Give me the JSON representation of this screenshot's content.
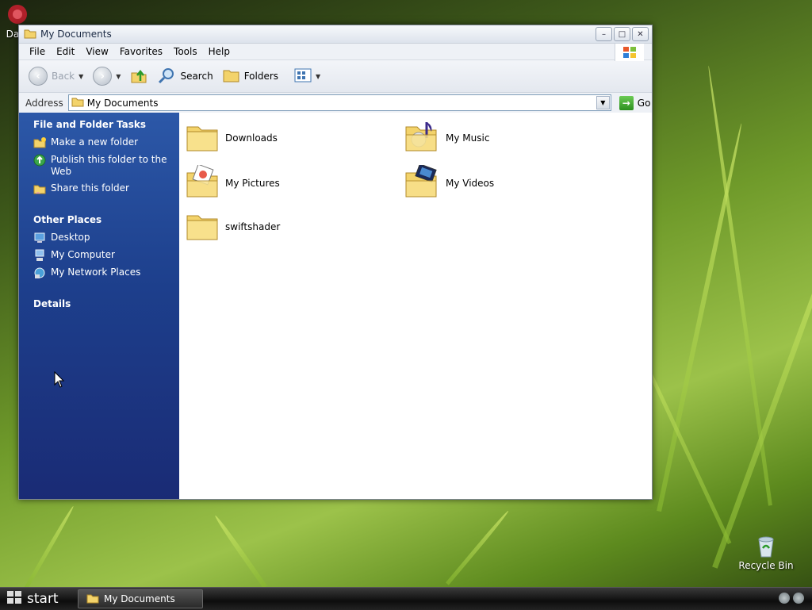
{
  "desktop": {
    "top_left_icon_label": "Data",
    "recycle_bin_label": "Recycle Bin"
  },
  "window": {
    "title": "My Documents",
    "controls": {
      "minimize": "–",
      "maximize": "□",
      "close": "✕"
    }
  },
  "menu": [
    "File",
    "Edit",
    "View",
    "Favorites",
    "Tools",
    "Help"
  ],
  "toolbar": {
    "back": "Back",
    "search": "Search",
    "folders": "Folders"
  },
  "address": {
    "label": "Address",
    "value": "My Documents",
    "go": "Go"
  },
  "taskpane": {
    "file_tasks_title": "File and Folder Tasks",
    "file_tasks": [
      "Make a new folder",
      "Publish this folder to the Web",
      "Share this folder"
    ],
    "other_places_title": "Other Places",
    "other_places": [
      "Desktop",
      "My Computer",
      "My Network Places"
    ],
    "details_title": "Details"
  },
  "folders": [
    "Downloads",
    "My Music",
    "My Pictures",
    "My Videos",
    "swiftshader"
  ],
  "taskbar": {
    "start_label": "start",
    "window_button": "My Documents"
  },
  "colors": {
    "taskpane_top": "#2c58a8",
    "taskpane_bottom": "#1a2b75",
    "folder_yellow": "#f3d36b"
  }
}
